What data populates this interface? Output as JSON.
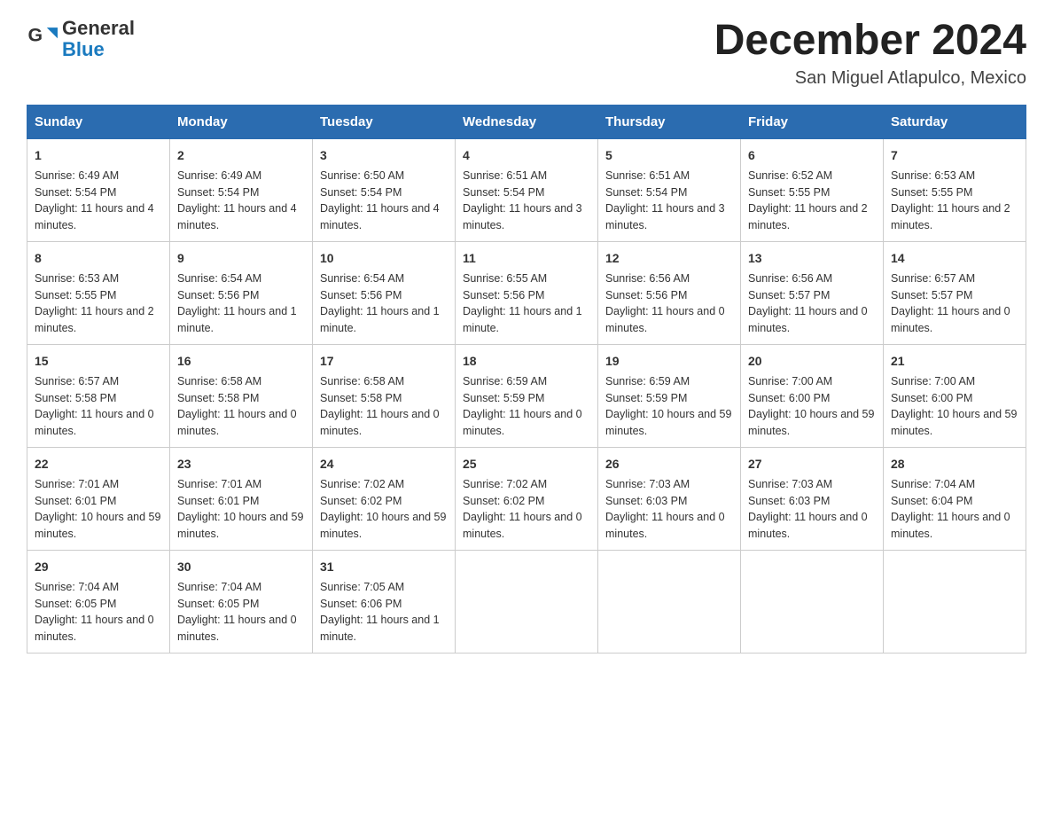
{
  "logo": {
    "line1": "General",
    "line2": "Blue",
    "arrow_color": "#1a7abf"
  },
  "header": {
    "title": "December 2024",
    "subtitle": "San Miguel Atlapulco, Mexico"
  },
  "days_of_week": [
    "Sunday",
    "Monday",
    "Tuesday",
    "Wednesday",
    "Thursday",
    "Friday",
    "Saturday"
  ],
  "weeks": [
    [
      {
        "day": "1",
        "sunrise": "6:49 AM",
        "sunset": "5:54 PM",
        "daylight": "11 hours and 4 minutes."
      },
      {
        "day": "2",
        "sunrise": "6:49 AM",
        "sunset": "5:54 PM",
        "daylight": "11 hours and 4 minutes."
      },
      {
        "day": "3",
        "sunrise": "6:50 AM",
        "sunset": "5:54 PM",
        "daylight": "11 hours and 4 minutes."
      },
      {
        "day": "4",
        "sunrise": "6:51 AM",
        "sunset": "5:54 PM",
        "daylight": "11 hours and 3 minutes."
      },
      {
        "day": "5",
        "sunrise": "6:51 AM",
        "sunset": "5:54 PM",
        "daylight": "11 hours and 3 minutes."
      },
      {
        "day": "6",
        "sunrise": "6:52 AM",
        "sunset": "5:55 PM",
        "daylight": "11 hours and 2 minutes."
      },
      {
        "day": "7",
        "sunrise": "6:53 AM",
        "sunset": "5:55 PM",
        "daylight": "11 hours and 2 minutes."
      }
    ],
    [
      {
        "day": "8",
        "sunrise": "6:53 AM",
        "sunset": "5:55 PM",
        "daylight": "11 hours and 2 minutes."
      },
      {
        "day": "9",
        "sunrise": "6:54 AM",
        "sunset": "5:56 PM",
        "daylight": "11 hours and 1 minute."
      },
      {
        "day": "10",
        "sunrise": "6:54 AM",
        "sunset": "5:56 PM",
        "daylight": "11 hours and 1 minute."
      },
      {
        "day": "11",
        "sunrise": "6:55 AM",
        "sunset": "5:56 PM",
        "daylight": "11 hours and 1 minute."
      },
      {
        "day": "12",
        "sunrise": "6:56 AM",
        "sunset": "5:56 PM",
        "daylight": "11 hours and 0 minutes."
      },
      {
        "day": "13",
        "sunrise": "6:56 AM",
        "sunset": "5:57 PM",
        "daylight": "11 hours and 0 minutes."
      },
      {
        "day": "14",
        "sunrise": "6:57 AM",
        "sunset": "5:57 PM",
        "daylight": "11 hours and 0 minutes."
      }
    ],
    [
      {
        "day": "15",
        "sunrise": "6:57 AM",
        "sunset": "5:58 PM",
        "daylight": "11 hours and 0 minutes."
      },
      {
        "day": "16",
        "sunrise": "6:58 AM",
        "sunset": "5:58 PM",
        "daylight": "11 hours and 0 minutes."
      },
      {
        "day": "17",
        "sunrise": "6:58 AM",
        "sunset": "5:58 PM",
        "daylight": "11 hours and 0 minutes."
      },
      {
        "day": "18",
        "sunrise": "6:59 AM",
        "sunset": "5:59 PM",
        "daylight": "11 hours and 0 minutes."
      },
      {
        "day": "19",
        "sunrise": "6:59 AM",
        "sunset": "5:59 PM",
        "daylight": "10 hours and 59 minutes."
      },
      {
        "day": "20",
        "sunrise": "7:00 AM",
        "sunset": "6:00 PM",
        "daylight": "10 hours and 59 minutes."
      },
      {
        "day": "21",
        "sunrise": "7:00 AM",
        "sunset": "6:00 PM",
        "daylight": "10 hours and 59 minutes."
      }
    ],
    [
      {
        "day": "22",
        "sunrise": "7:01 AM",
        "sunset": "6:01 PM",
        "daylight": "10 hours and 59 minutes."
      },
      {
        "day": "23",
        "sunrise": "7:01 AM",
        "sunset": "6:01 PM",
        "daylight": "10 hours and 59 minutes."
      },
      {
        "day": "24",
        "sunrise": "7:02 AM",
        "sunset": "6:02 PM",
        "daylight": "10 hours and 59 minutes."
      },
      {
        "day": "25",
        "sunrise": "7:02 AM",
        "sunset": "6:02 PM",
        "daylight": "11 hours and 0 minutes."
      },
      {
        "day": "26",
        "sunrise": "7:03 AM",
        "sunset": "6:03 PM",
        "daylight": "11 hours and 0 minutes."
      },
      {
        "day": "27",
        "sunrise": "7:03 AM",
        "sunset": "6:03 PM",
        "daylight": "11 hours and 0 minutes."
      },
      {
        "day": "28",
        "sunrise": "7:04 AM",
        "sunset": "6:04 PM",
        "daylight": "11 hours and 0 minutes."
      }
    ],
    [
      {
        "day": "29",
        "sunrise": "7:04 AM",
        "sunset": "6:05 PM",
        "daylight": "11 hours and 0 minutes."
      },
      {
        "day": "30",
        "sunrise": "7:04 AM",
        "sunset": "6:05 PM",
        "daylight": "11 hours and 0 minutes."
      },
      {
        "day": "31",
        "sunrise": "7:05 AM",
        "sunset": "6:06 PM",
        "daylight": "11 hours and 1 minute."
      },
      null,
      null,
      null,
      null
    ]
  ]
}
